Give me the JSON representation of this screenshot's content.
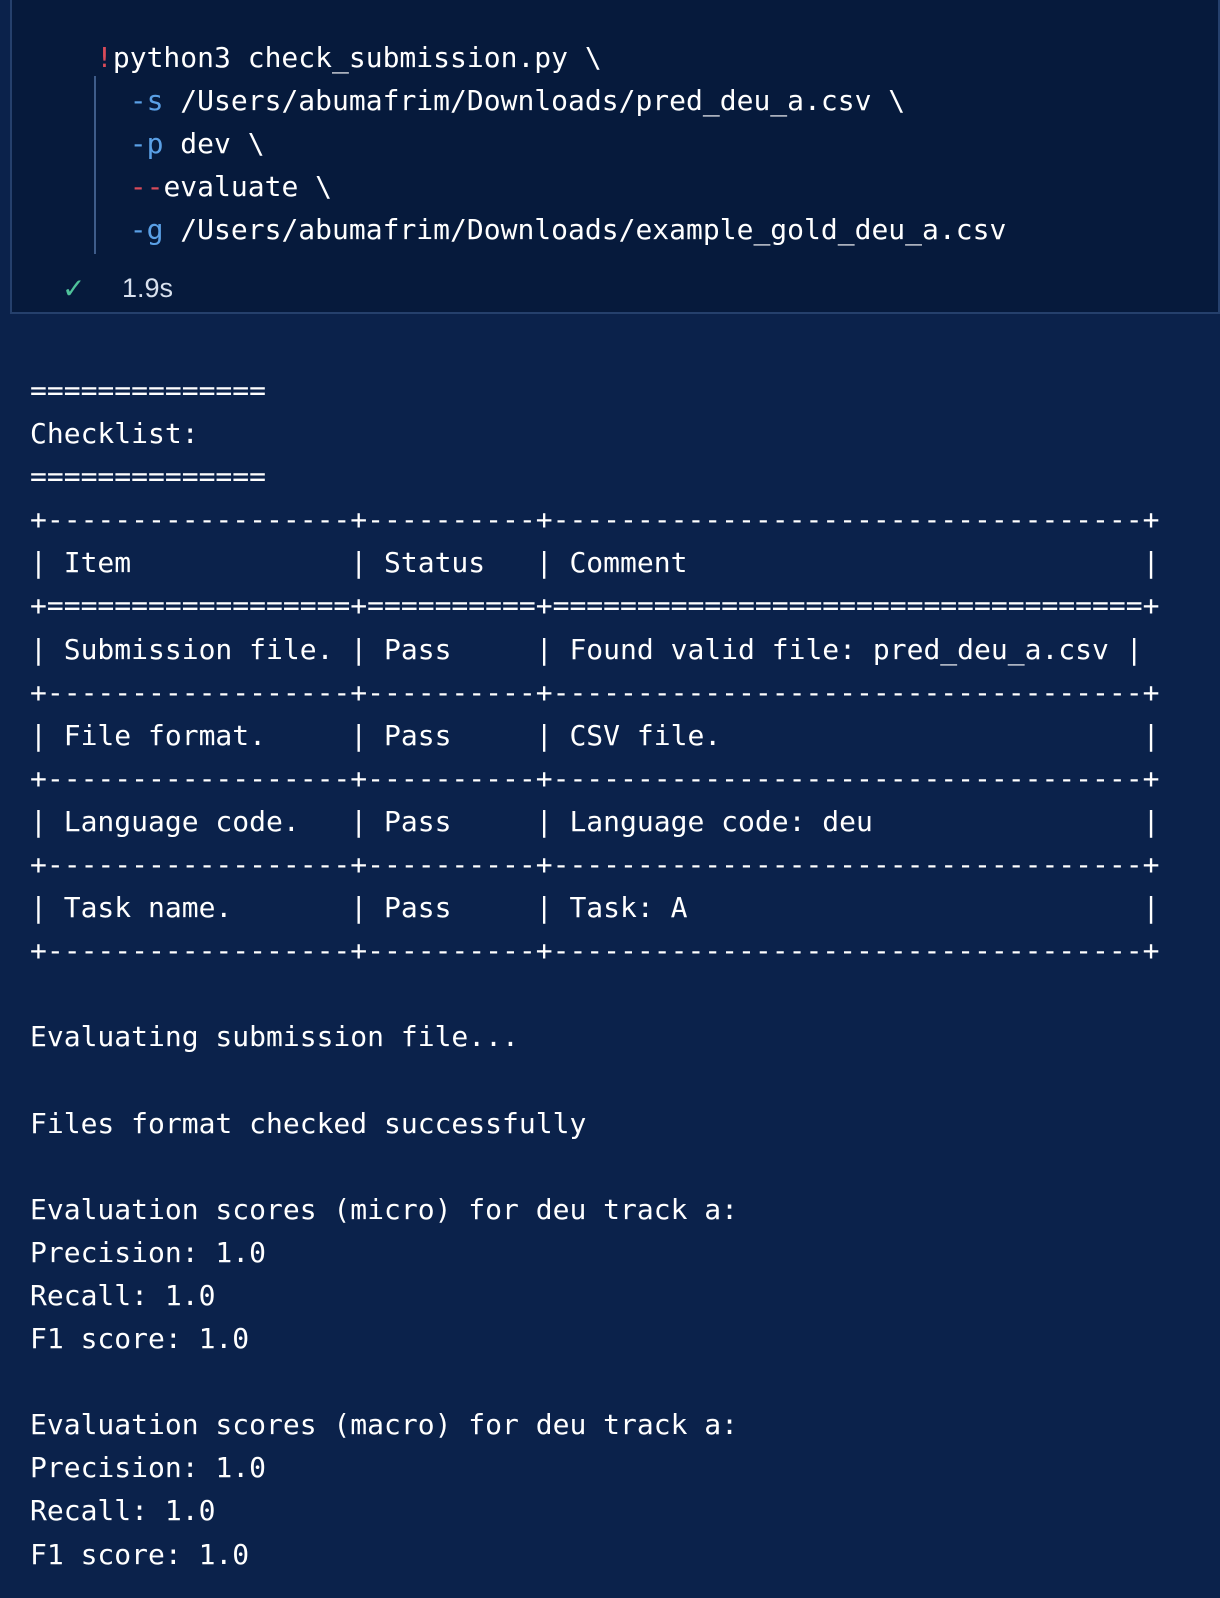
{
  "cell": {
    "command": {
      "bang": "!",
      "line1_rest": "python3 check_submission.py \\",
      "line2_flag": "-s",
      "line2_path": " /Users/abumafrim/Downloads/pred_deu_a.csv \\",
      "line3_flag": "-p",
      "line3_rest": " dev \\",
      "line4_dash": "--",
      "line4_rest": "evaluate \\",
      "line5_flag": "-g",
      "line5_path": " /Users/abumafrim/Downloads/example_gold_deu_a.csv"
    },
    "status_icon": "check-icon",
    "duration": "1.9s"
  },
  "output": {
    "rule_line": "==============",
    "checklist_title": "Checklist:",
    "table": {
      "border": "+------------------+----------+-----------------------------------+",
      "header_sep": "+==================+==========+===================================+",
      "header_row": "| Item             | Status   | Comment                           |",
      "rows": [
        "| Submission file. | Pass     | Found valid file: pred_deu_a.csv |",
        "| File format.     | Pass     | CSV file.                         |",
        "| Language code.   | Pass     | Language code: deu                |",
        "| Task name.       | Pass     | Task: A                           |"
      ]
    },
    "evaluating": "Evaluating submission file...",
    "format_ok": "Files format checked successfully",
    "micro": {
      "heading": "Evaluation scores (micro) for deu track a:",
      "precision": "Precision: 1.0",
      "recall": "Recall: 1.0",
      "f1": "F1 score: 1.0"
    },
    "macro": {
      "heading": "Evaluation scores (macro) for deu track a:",
      "precision": "Precision: 1.0",
      "recall": "Recall: 1.0",
      "f1": "F1 score: 1.0"
    }
  }
}
